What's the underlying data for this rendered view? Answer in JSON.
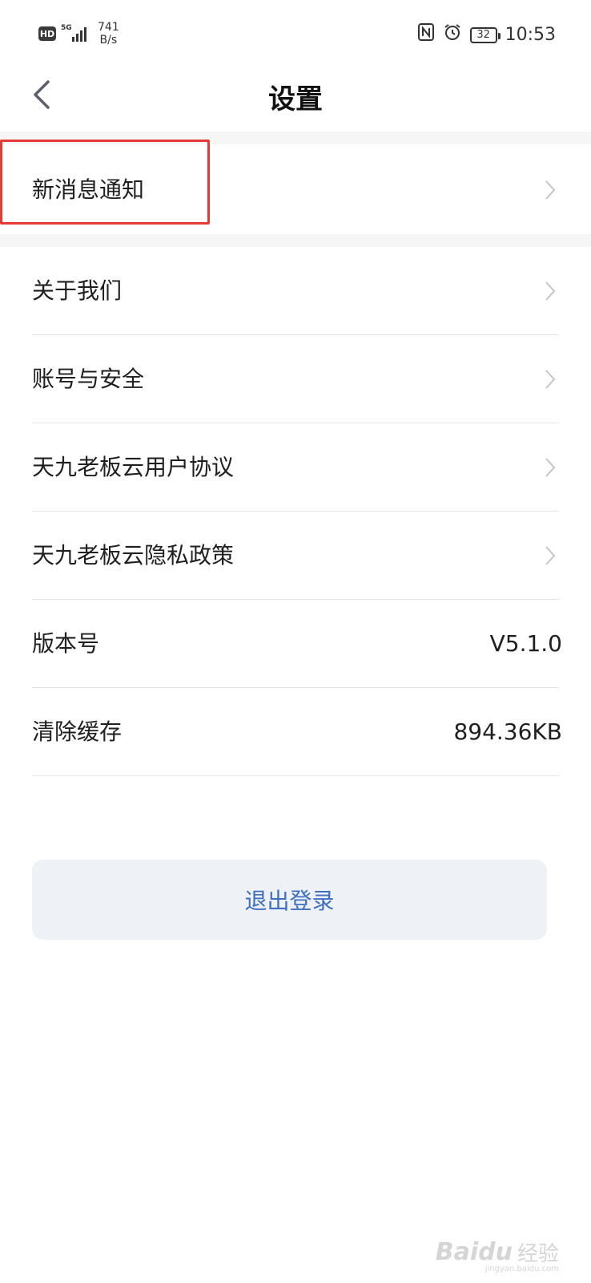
{
  "status_bar": {
    "hd": "HD",
    "network": "5G",
    "speed_value": "741",
    "speed_unit": "B/s",
    "battery": "32",
    "time": "10:53",
    "icons": [
      "nfc-icon",
      "alarm-icon",
      "battery-icon"
    ]
  },
  "header": {
    "title": "设置",
    "back_icon": "chevron-left-icon"
  },
  "settings": {
    "notifications": {
      "label": "新消息通知"
    },
    "items": [
      {
        "label": "关于我们"
      },
      {
        "label": "账号与安全"
      },
      {
        "label": "天九老板云用户协议"
      },
      {
        "label": "天九老板云隐私政策"
      },
      {
        "label": "版本号",
        "value": "V5.1.0"
      },
      {
        "label": "清除缓存",
        "value": "894.36KB"
      }
    ]
  },
  "logout": {
    "label": "退出登录"
  },
  "watermark": {
    "text": "Bai",
    "suffix": "du",
    "cn": "经验",
    "sub": "jingyan.baidu.com"
  },
  "colors": {
    "accent": "#3f6fc0",
    "highlight": "#e53935",
    "band": "#f6f6f6",
    "button_bg": "#eef1f6"
  }
}
